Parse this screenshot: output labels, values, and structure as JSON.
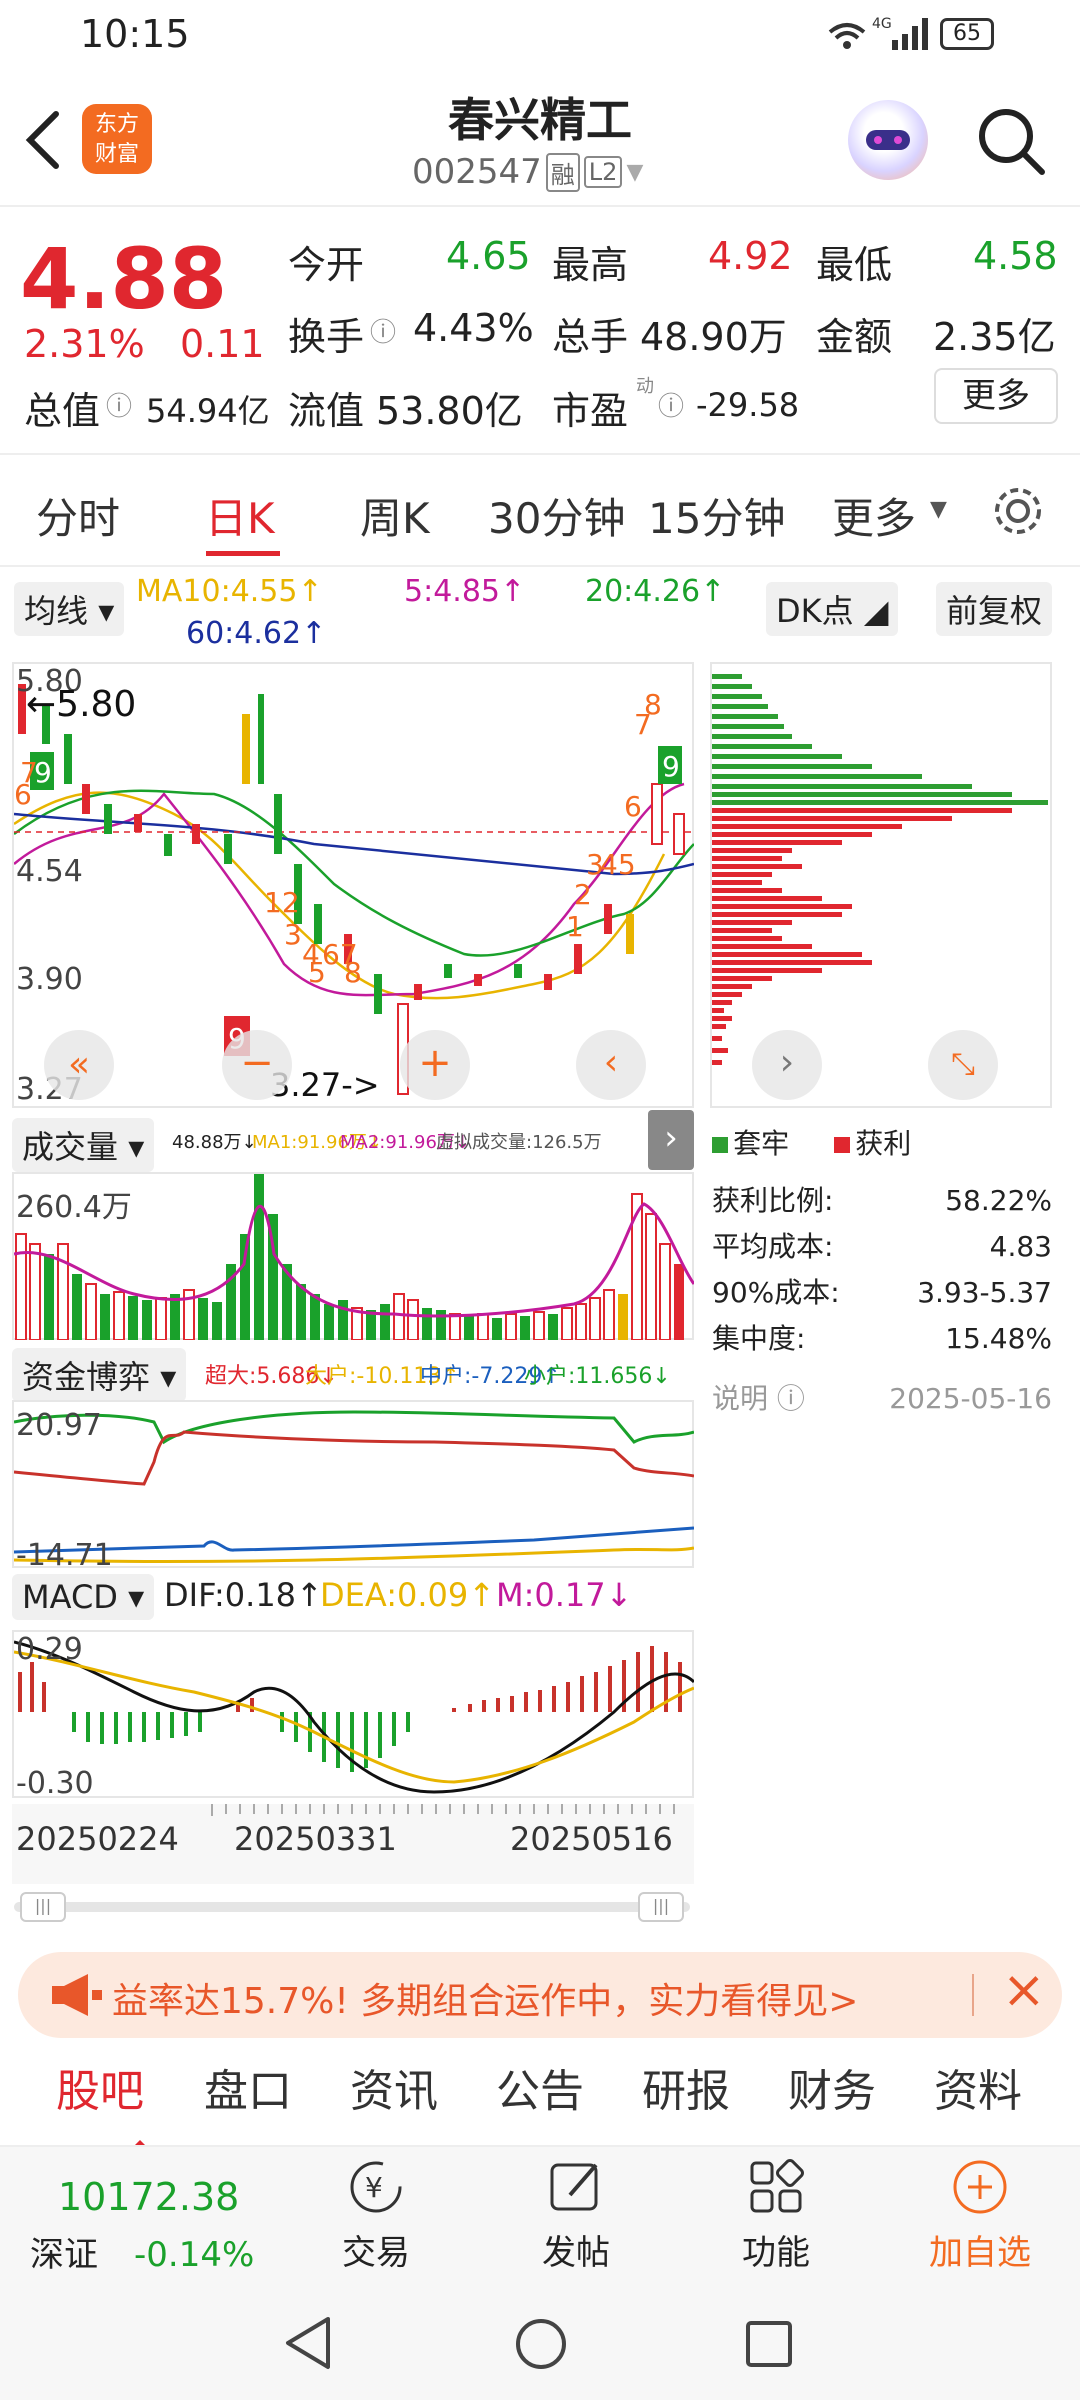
{
  "status": {
    "time": "10:15",
    "battery": "65"
  },
  "header": {
    "title": "春兴精工",
    "code": "002547",
    "badge1": "融",
    "badge2": "L2",
    "logo_line1": "东方",
    "logo_line2": "财富"
  },
  "quote": {
    "price": "4.88",
    "change_pct": "2.31%",
    "change": "0.11",
    "rows": [
      [
        {
          "k": "今开",
          "v": "4.65",
          "c": "green"
        },
        {
          "k": "最高",
          "v": "4.92",
          "c": "red"
        },
        {
          "k": "最低",
          "v": "4.58",
          "c": "green"
        }
      ],
      [
        {
          "k": "换手",
          "v": "4.43%",
          "c": "dark"
        },
        {
          "k": "总手",
          "v": "48.90万",
          "c": "dark"
        },
        {
          "k": "金额",
          "v": "2.35亿",
          "c": "dark"
        }
      ]
    ],
    "total_value_label": "总值",
    "total_value": "54.94亿",
    "float_value_label": "流值",
    "float_value": "53.80亿",
    "pe_label": "市盈",
    "pe_super": "动",
    "pe_value": "-29.58",
    "more": "更多"
  },
  "tabs": [
    "分时",
    "日K",
    "周K",
    "30分钟",
    "15分钟",
    "更多"
  ],
  "ma_bar": {
    "selector": "均线",
    "ma10": "MA10:4.55↑",
    "ma5": "5:4.85↑",
    "ma20": "20:4.26↑",
    "ma60": "60:4.62↑",
    "dk": "DK点",
    "fq": "前复权"
  },
  "kline": {
    "y_top": "5.80",
    "y_mid": "4.54",
    "y_low2": "3.90",
    "y_bottom": "3.27",
    "max_label": "5.80",
    "min_label": "3.27->"
  },
  "chip": {
    "legend_a": "套牢",
    "legend_b": "获利",
    "stats": [
      {
        "k": "获利比例:",
        "v": "58.22%"
      },
      {
        "k": "平均成本:",
        "v": "4.83"
      },
      {
        "k": "90%成本:",
        "v": "3.93-5.37"
      },
      {
        "k": "集中度:",
        "v": "15.48%"
      }
    ],
    "note": "说明",
    "date": "2025-05-16"
  },
  "volume": {
    "selector": "成交量",
    "v1": "48.88万↓",
    "ma1": "MA1:91.96万↓",
    "ma2": "MA2:91.96万↓",
    "virtual": "虚拟成交量:126.5万",
    "y_top": "260.4万"
  },
  "fund": {
    "selector": "资金博弈",
    "super": "超大:5.686↓",
    "big": "大户:-10.113↑",
    "mid": "中户:-7.229↑",
    "small": "小户:11.656↓",
    "y_top": "20.97",
    "y_bottom": "-14.71"
  },
  "macd": {
    "selector": "MACD",
    "dif": "DIF:0.18↑",
    "dea": "DEA:0.09↑",
    "m": "M:0.17↓",
    "y_top": "0.29",
    "y_bottom": "-0.30"
  },
  "dates": [
    "20250224",
    "20250331",
    "20250516"
  ],
  "banner": {
    "text": "益率达15.7%!  多期组合运作中，实力看得见>"
  },
  "bottom_tabs": [
    "股吧",
    "盘口",
    "资讯",
    "公告",
    "研报",
    "财务",
    "资料"
  ],
  "dock": {
    "index_value": "10172.38",
    "index_name": "深证",
    "index_change": "-0.14%",
    "trade": "交易",
    "post": "发帖",
    "func": "功能",
    "add": "加自选"
  },
  "colors": {
    "red": "#e0272f",
    "green": "#1aa12b",
    "orange": "#f36b21",
    "ma5": "#c21a9b",
    "ma10": "#e8b400",
    "ma20": "#1aa12b",
    "ma60": "#1b2f9e"
  }
}
